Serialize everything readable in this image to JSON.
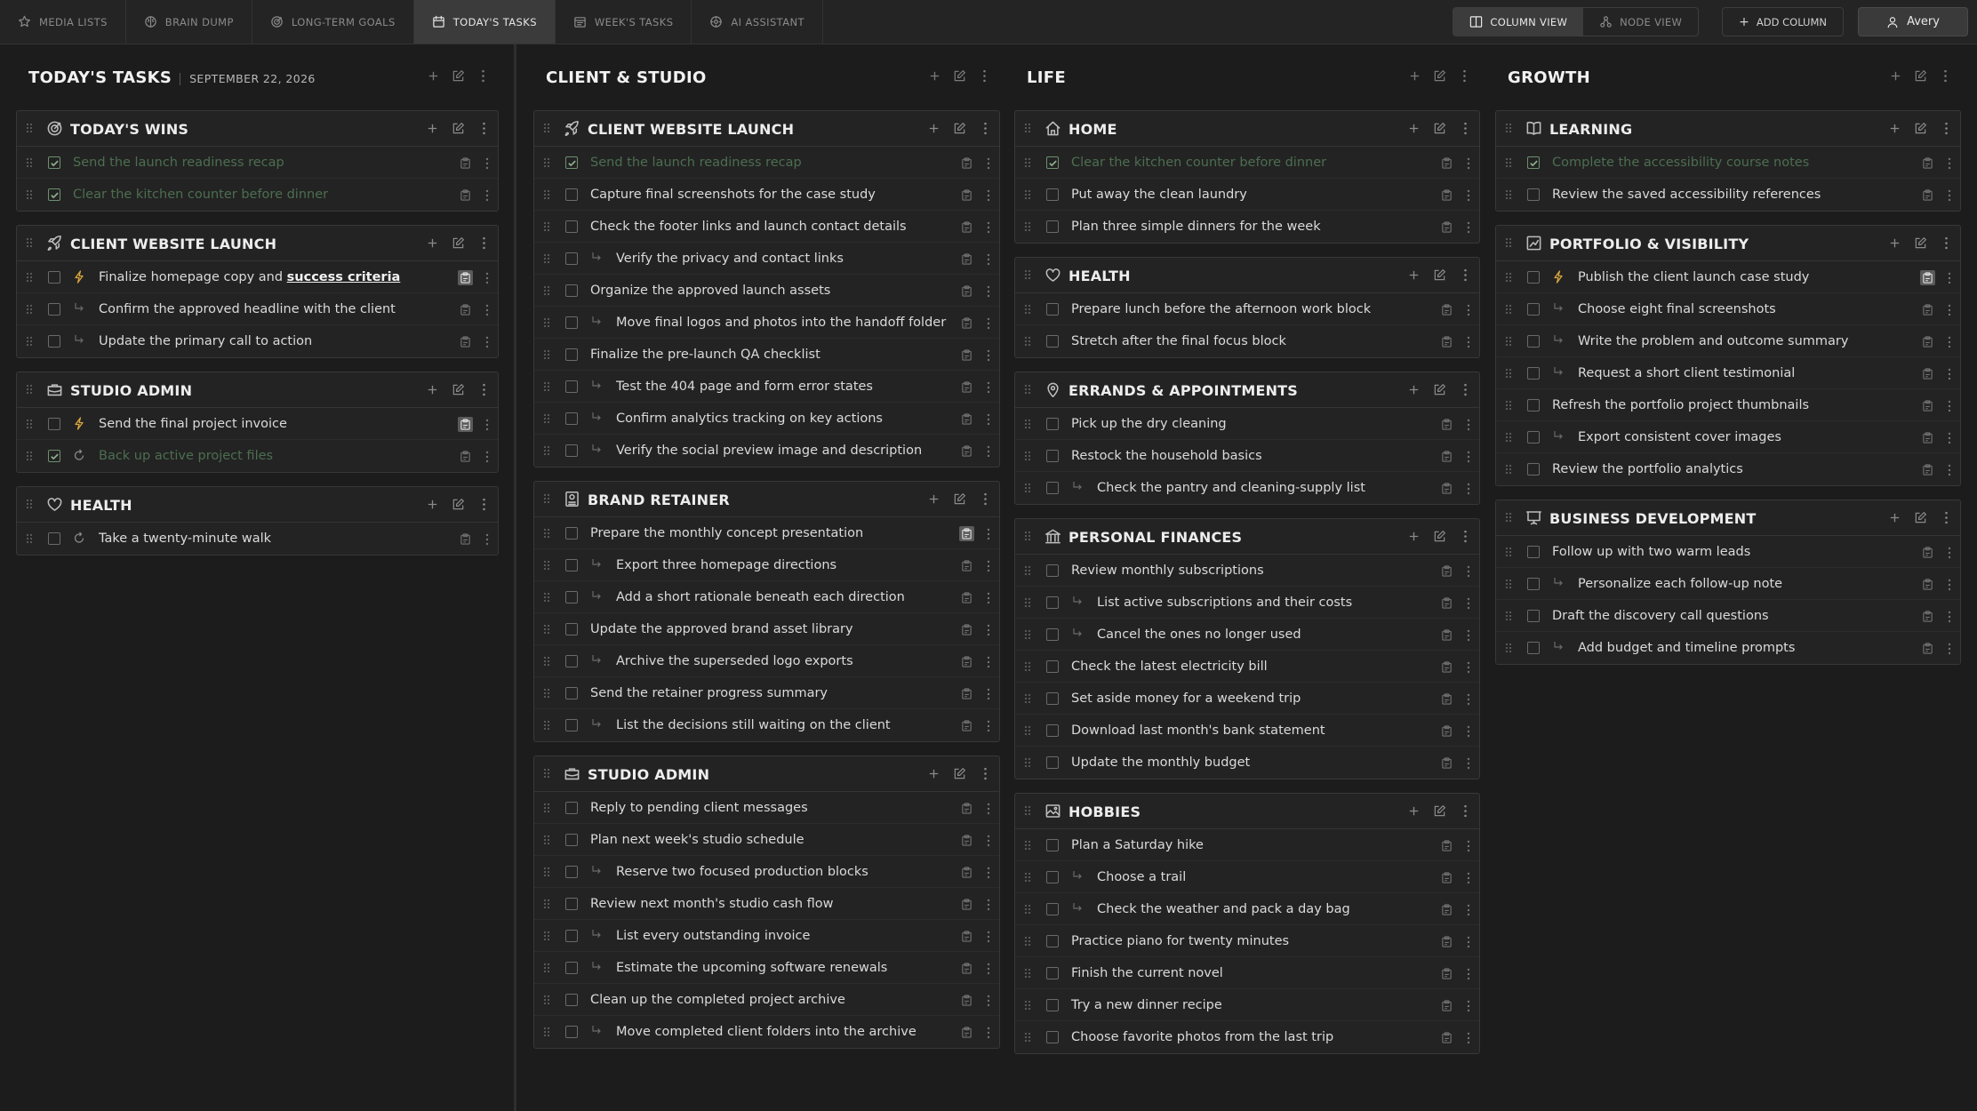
{
  "nav": {
    "tabs": [
      {
        "label": "MEDIA LISTS",
        "icon": "star-icon"
      },
      {
        "label": "BRAIN DUMP",
        "icon": "brain-icon"
      },
      {
        "label": "LONG-TERM GOALS",
        "icon": "target-icon"
      },
      {
        "label": "TODAY'S TASKS",
        "icon": "calendar-icon",
        "active": true
      },
      {
        "label": "WEEK'S TASKS",
        "icon": "calendar-week-icon"
      },
      {
        "label": "AI ASSISTANT",
        "icon": "ai-icon"
      }
    ],
    "views": {
      "column": "COLUMN VIEW",
      "node": "NODE VIEW"
    },
    "add_column": "ADD COLUMN",
    "user": "Avery"
  },
  "today": {
    "title": "TODAY'S TASKS",
    "date": "SEPTEMBER 22, 2026",
    "cards": [
      {
        "title": "TODAY'S WINS",
        "icon": "target-icon",
        "items": [
          {
            "text": "Send the launch readiness recap",
            "done": true
          },
          {
            "text": "Clear the kitchen counter before dinner",
            "done": true
          }
        ]
      },
      {
        "title": "CLIENT WEBSITE LAUNCH",
        "icon": "rocket-icon",
        "items": [
          {
            "text": "Finalize homepage copy and ",
            "strong": "success criteria",
            "flag": "bolt",
            "highlight": true
          },
          {
            "text": "Confirm the approved headline with the client",
            "sub": true
          },
          {
            "text": "Update the primary call to action",
            "sub": true
          }
        ]
      },
      {
        "title": "STUDIO ADMIN",
        "icon": "briefcase-icon",
        "items": [
          {
            "text": "Send the final project invoice",
            "flag": "bolt",
            "highlight": true
          },
          {
            "text": "Back up active project files",
            "done": true,
            "flag": "loop"
          }
        ]
      },
      {
        "title": "HEALTH",
        "icon": "heart-icon",
        "items": [
          {
            "text": "Take a twenty-minute walk",
            "flag": "loop"
          }
        ]
      }
    ]
  },
  "client": {
    "title": "CLIENT & STUDIO",
    "cards": [
      {
        "title": "CLIENT WEBSITE LAUNCH",
        "icon": "rocket-icon",
        "items": [
          {
            "text": "Send the launch readiness recap",
            "done": true
          },
          {
            "text": "Capture final screenshots for the case study"
          },
          {
            "text": "Check the footer links and launch contact details"
          },
          {
            "text": "Verify the privacy and contact links",
            "sub": true
          },
          {
            "text": "Organize the approved launch assets"
          },
          {
            "text": "Move final logos and photos into the handoff folder",
            "sub": true
          },
          {
            "text": "Finalize the pre-launch QA checklist"
          },
          {
            "text": "Test the 404 page and form error states",
            "sub": true
          },
          {
            "text": "Confirm analytics tracking on key actions",
            "sub": true
          },
          {
            "text": "Verify the social preview image and description",
            "sub": true
          }
        ]
      },
      {
        "title": "BRAND RETAINER",
        "icon": "badge-icon",
        "items": [
          {
            "text": "Prepare the monthly concept presentation",
            "highlight": true
          },
          {
            "text": "Export three homepage directions",
            "sub": true
          },
          {
            "text": "Add a short rationale beneath each direction",
            "sub": true
          },
          {
            "text": "Update the approved brand asset library"
          },
          {
            "text": "Archive the superseded logo exports",
            "sub": true
          },
          {
            "text": "Send the retainer progress summary"
          },
          {
            "text": "List the decisions still waiting on the client",
            "sub": true
          }
        ]
      },
      {
        "title": "STUDIO ADMIN",
        "icon": "briefcase-icon",
        "items": [
          {
            "text": "Reply to pending client messages"
          },
          {
            "text": "Plan next week's studio schedule"
          },
          {
            "text": "Reserve two focused production blocks",
            "sub": true
          },
          {
            "text": "Review next month's studio cash flow"
          },
          {
            "text": "List every outstanding invoice",
            "sub": true
          },
          {
            "text": "Estimate the upcoming software renewals",
            "sub": true
          },
          {
            "text": "Clean up the completed project archive"
          },
          {
            "text": "Move completed client folders into the archive",
            "sub": true
          }
        ]
      }
    ]
  },
  "life": {
    "title": "LIFE",
    "cards": [
      {
        "title": "HOME",
        "icon": "home-icon",
        "items": [
          {
            "text": "Clear the kitchen counter before dinner",
            "done": true
          },
          {
            "text": "Put away the clean laundry"
          },
          {
            "text": "Plan three simple dinners for the week"
          }
        ]
      },
      {
        "title": "HEALTH",
        "icon": "heart-icon",
        "items": [
          {
            "text": "Prepare lunch before the afternoon work block"
          },
          {
            "text": "Stretch after the final focus block"
          }
        ]
      },
      {
        "title": "ERRANDS & APPOINTMENTS",
        "icon": "map-pin-icon",
        "items": [
          {
            "text": "Pick up the dry cleaning"
          },
          {
            "text": "Restock the household basics"
          },
          {
            "text": "Check the pantry and cleaning-supply list",
            "sub": true
          }
        ]
      },
      {
        "title": "PERSONAL FINANCES",
        "icon": "bank-icon",
        "items": [
          {
            "text": "Review monthly subscriptions"
          },
          {
            "text": "List active subscriptions and their costs",
            "sub": true
          },
          {
            "text": "Cancel the ones no longer used",
            "sub": true
          },
          {
            "text": "Check the latest electricity bill"
          },
          {
            "text": "Set aside money for a weekend trip"
          },
          {
            "text": "Download last month's bank statement"
          },
          {
            "text": "Update the monthly budget"
          }
        ]
      },
      {
        "title": "HOBBIES",
        "icon": "image-icon",
        "items": [
          {
            "text": "Plan a Saturday hike"
          },
          {
            "text": "Choose a trail",
            "sub": true
          },
          {
            "text": "Check the weather and pack a day bag",
            "sub": true
          },
          {
            "text": "Practice piano for twenty minutes"
          },
          {
            "text": "Finish the current novel"
          },
          {
            "text": "Try a new dinner recipe"
          },
          {
            "text": "Choose favorite photos from the last trip"
          }
        ]
      }
    ]
  },
  "growth": {
    "title": "GROWTH",
    "cards": [
      {
        "title": "LEARNING",
        "icon": "book-icon",
        "items": [
          {
            "text": "Complete the accessibility course notes",
            "done": true
          },
          {
            "text": "Review the saved accessibility references"
          }
        ]
      },
      {
        "title": "PORTFOLIO & VISIBILITY",
        "icon": "chart-icon",
        "items": [
          {
            "text": "Publish the client launch case study",
            "flag": "bolt",
            "highlight": true
          },
          {
            "text": "Choose eight final screenshots",
            "sub": true
          },
          {
            "text": "Write the problem and outcome summary",
            "sub": true
          },
          {
            "text": "Request a short client testimonial",
            "sub": true
          },
          {
            "text": "Refresh the portfolio project thumbnails"
          },
          {
            "text": "Export consistent cover images",
            "sub": true
          },
          {
            "text": "Review the portfolio analytics"
          }
        ]
      },
      {
        "title": "BUSINESS DEVELOPMENT",
        "icon": "presentation-icon",
        "items": [
          {
            "text": "Follow up with two warm leads"
          },
          {
            "text": "Personalize each follow-up note",
            "sub": true
          },
          {
            "text": "Draft the discovery call questions"
          },
          {
            "text": "Add budget and timeline prompts",
            "sub": true
          }
        ]
      }
    ]
  }
}
